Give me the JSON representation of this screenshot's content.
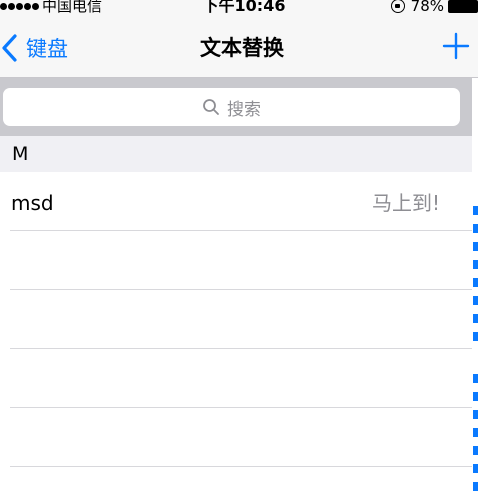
{
  "status_bar": {
    "carrier": "中国电信",
    "time": "下午10:46",
    "battery": "78%"
  },
  "nav": {
    "back_label": "键盘",
    "title": "文本替换",
    "add_icon": "plus-icon",
    "back_icon": "chevron-left-icon"
  },
  "search": {
    "placeholder": "搜索",
    "icon": "search-icon"
  },
  "section": {
    "letter": "M"
  },
  "rows": [
    {
      "shortcut": "msd",
      "phrase": "马上到!"
    },
    {
      "shortcut": "",
      "phrase": ""
    },
    {
      "shortcut": "",
      "phrase": ""
    },
    {
      "shortcut": "",
      "phrase": ""
    },
    {
      "shortcut": "",
      "phrase": ""
    }
  ],
  "colors": {
    "accent": "#0a7aff",
    "search_bg": "#c9c9ce",
    "bar_bg": "#f7f7f7"
  }
}
